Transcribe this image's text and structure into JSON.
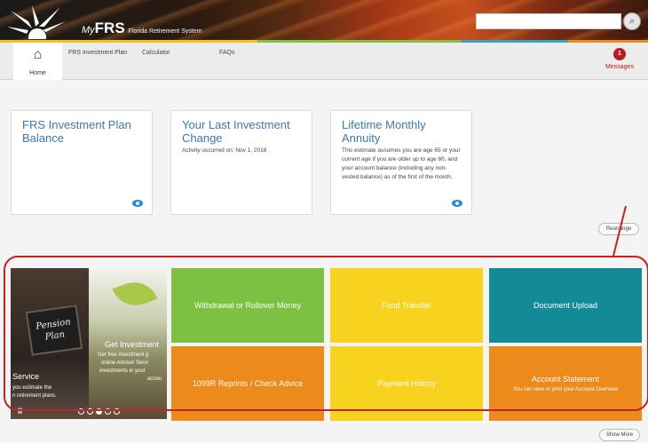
{
  "header": {
    "brand_my": "My",
    "brand_frs": "FRS",
    "brand_system": "Florida Retirement System",
    "search_placeholder": ""
  },
  "nav": {
    "home": "Home",
    "links": [
      "FRS Investment Plan",
      "Calculator",
      "FAQs"
    ],
    "messages_count": "1",
    "messages_label": "Messages"
  },
  "cards": [
    {
      "title": "FRS Investment Plan Balance",
      "body": ""
    },
    {
      "title": "Your Last Investment Change",
      "body": "Activity occurred on: Nov 1, 2018"
    },
    {
      "title": "Lifetime Monthly Annuity",
      "body": "This estimate assumes you are age 65 or your current age if you are older up to age 80, and your account balance (including any non-vested balance) as of the first of the month."
    }
  ],
  "buttons": {
    "rearrange": "Rearrange",
    "show_more": "Show More"
  },
  "carousel": {
    "sign_line1": "Pension",
    "sign_line2": "Plan",
    "left_heading": "Service",
    "left_text_1": "you estimate the",
    "left_text_2": "n retirement plans.",
    "right_heading": "Get Investment",
    "right_text_1": "Get free investment g",
    "right_text_2": "online Advisor Servi",
    "right_text_3": "investments in your",
    "right_text_4": "accou",
    "pause": "II",
    "active_slide": 3
  },
  "tiles": [
    {
      "title": "Withdrawal or Rollover Money",
      "sub": "",
      "color": "#7cc142"
    },
    {
      "title": "Fund Transfer",
      "sub": "",
      "color": "#f7d21e"
    },
    {
      "title": "Document Upload",
      "sub": "",
      "color": "#128a97"
    },
    {
      "title": "1099R Reprints / Check Advice",
      "sub": "",
      "color": "#ed8a1c"
    },
    {
      "title": "Payment History",
      "sub": "",
      "color": "#f7d21e"
    },
    {
      "title": "Account Statement",
      "sub": "You can view or print your Account Overview",
      "color": "#ed8a1c"
    }
  ],
  "colors": {
    "accent_blue": "#3a79b8",
    "alert_red": "#c92020",
    "bar": [
      "#f2c21a",
      "#7cc142",
      "#2aa5c8",
      "#ed8a1c"
    ]
  }
}
